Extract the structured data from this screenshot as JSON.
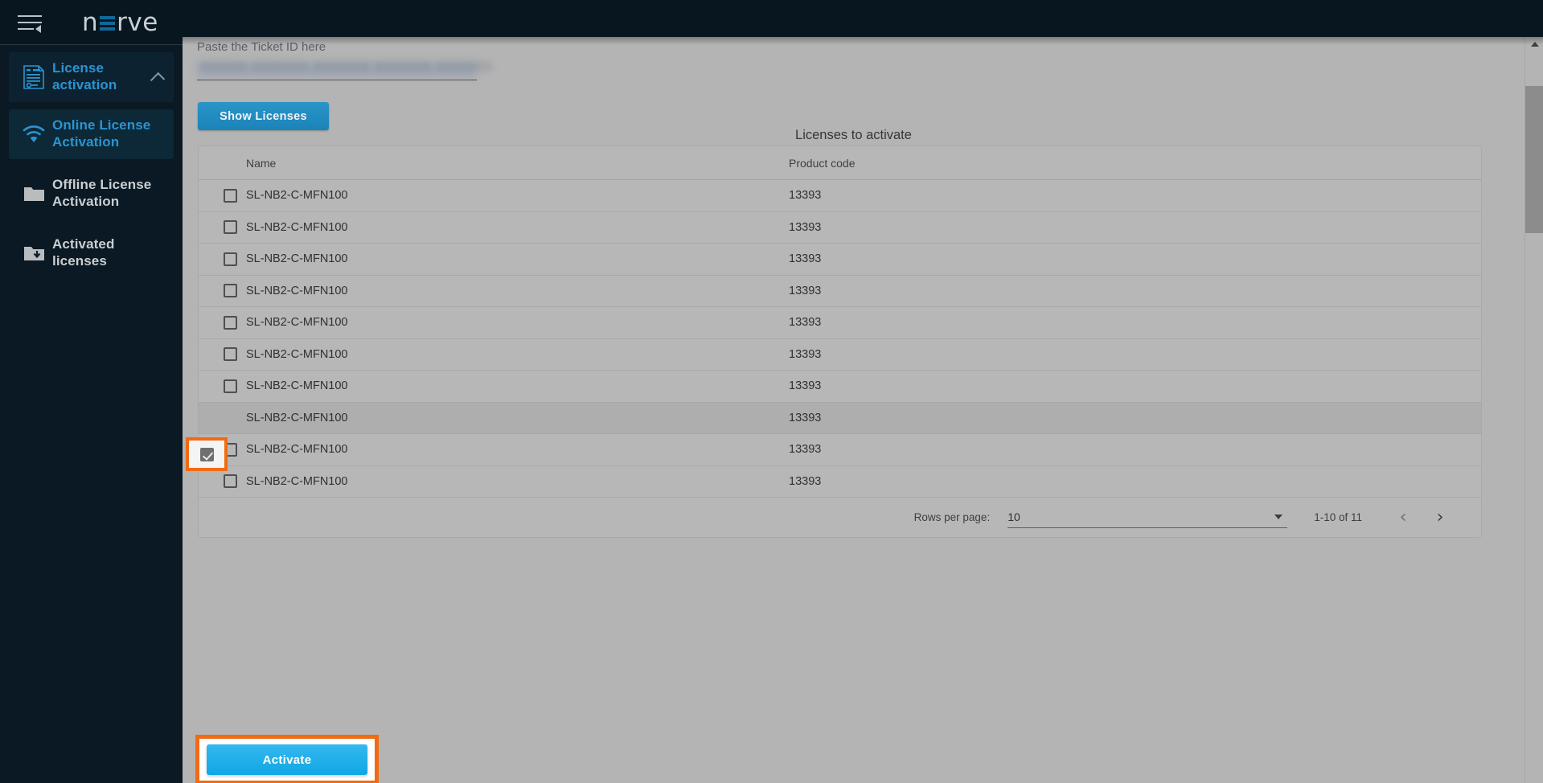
{
  "topbar": {
    "menu_icon": "hamburger-collapse-icon",
    "logo_text_pre": "n",
    "logo_text_post": "rve",
    "logo_accent_color": "#0f6a9b"
  },
  "sidebar": {
    "items": [
      {
        "label": "License activation",
        "icon": "license-document-icon",
        "state": "expanded-parent",
        "has_chevron": true
      },
      {
        "label": "Online License Activation",
        "icon": "wifi-icon",
        "state": "active"
      },
      {
        "label": "Offline License Activation",
        "icon": "folder-icon",
        "state": "default"
      },
      {
        "label": "Activated licenses",
        "icon": "folder-download-icon",
        "state": "default"
      }
    ]
  },
  "main": {
    "ticket_field": {
      "label": "Paste the Ticket ID here",
      "value": "XXXXX-XXXXXX-XXXXXX-XXXXXX-XXXXXX",
      "redacted": true
    },
    "show_licenses_button": "Show Licenses",
    "table_title": "Licenses to activate",
    "columns": [
      "Name",
      "Product code"
    ],
    "rows": [
      {
        "checked": false,
        "name": "SL-NB2-C-MFN100",
        "code": "13393"
      },
      {
        "checked": false,
        "name": "SL-NB2-C-MFN100",
        "code": "13393"
      },
      {
        "checked": false,
        "name": "SL-NB2-C-MFN100",
        "code": "13393"
      },
      {
        "checked": false,
        "name": "SL-NB2-C-MFN100",
        "code": "13393"
      },
      {
        "checked": false,
        "name": "SL-NB2-C-MFN100",
        "code": "13393"
      },
      {
        "checked": false,
        "name": "SL-NB2-C-MFN100",
        "code": "13393"
      },
      {
        "checked": false,
        "name": "SL-NB2-C-MFN100",
        "code": "13393"
      },
      {
        "checked": true,
        "name": "SL-NB2-C-MFN100",
        "code": "13393"
      },
      {
        "checked": false,
        "name": "SL-NB2-C-MFN100",
        "code": "13393"
      },
      {
        "checked": false,
        "name": "SL-NB2-C-MFN100",
        "code": "13393"
      }
    ],
    "pagination": {
      "rows_per_page_label": "Rows per page:",
      "rows_per_page_value": "10",
      "range_text": "1-10 of 11",
      "prev_glyph": "‹",
      "next_glyph": "›"
    },
    "activate_button": "Activate"
  },
  "highlight_color": "#f26a12"
}
